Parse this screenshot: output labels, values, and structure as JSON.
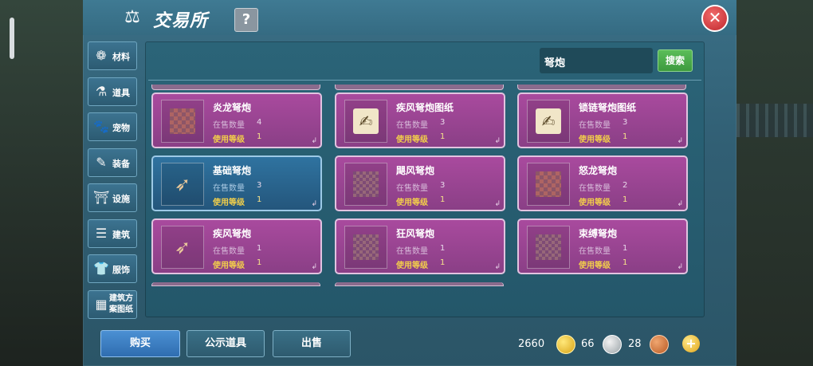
{
  "title": "交易所",
  "help_label": "?",
  "close_label": "✕",
  "sidebar": [
    {
      "label": "材料",
      "icon": "materials-icon",
      "glyph": "❁"
    },
    {
      "label": "道具",
      "icon": "flask-icon",
      "glyph": "⚗"
    },
    {
      "label": "宠物",
      "icon": "paw-icon",
      "glyph": "🐾"
    },
    {
      "label": "装备",
      "icon": "equipment-icon",
      "glyph": "✎"
    },
    {
      "label": "设施",
      "icon": "facility-icon",
      "glyph": "⛩"
    },
    {
      "label": "建筑",
      "icon": "building-icon",
      "glyph": "☰"
    },
    {
      "label": "服饰",
      "icon": "clothing-icon",
      "glyph": "👕"
    },
    {
      "label": "建筑方案图纸",
      "icon": "blueprint-icon",
      "glyph": "▦"
    }
  ],
  "search": {
    "value": "弩炮",
    "button": "搜索"
  },
  "labels": {
    "stock": "在售数量",
    "level": "使用等级"
  },
  "items": [
    {
      "name": "炎龙弩炮",
      "stock": "4",
      "level": "1",
      "thumb": "pixel"
    },
    {
      "name": "疾风弩炮图纸",
      "stock": "3",
      "level": "1",
      "thumb": "scroll"
    },
    {
      "name": "锁链弩炮图纸",
      "stock": "3",
      "level": "1",
      "thumb": "scroll"
    },
    {
      "name": "基础弩炮",
      "stock": "3",
      "level": "1",
      "thumb": "bow",
      "selected": true
    },
    {
      "name": "飓风弩炮",
      "stock": "3",
      "level": "1",
      "thumb": "pixel2"
    },
    {
      "name": "怒龙弩炮",
      "stock": "2",
      "level": "1",
      "thumb": "pixel"
    },
    {
      "name": "疾风弩炮",
      "stock": "1",
      "level": "1",
      "thumb": "bow"
    },
    {
      "name": "狂风弩炮",
      "stock": "1",
      "level": "1",
      "thumb": "pixel2"
    },
    {
      "name": "束缚弩炮",
      "stock": "1",
      "level": "1",
      "thumb": "pixel2"
    }
  ],
  "bottom": {
    "buy": "购买",
    "public_items": "公示道具",
    "sell": "出售"
  },
  "currency": {
    "gold": "2660",
    "silver": "66",
    "bronze": "28"
  }
}
